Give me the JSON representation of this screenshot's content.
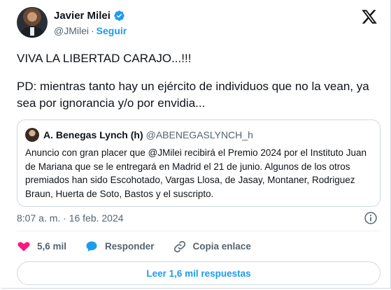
{
  "author": {
    "name": "Javier Milei",
    "handle": "@JMilei",
    "separator": "·",
    "follow_label": "Seguir"
  },
  "tweet": {
    "line1": "VIVA LA LIBERTAD CARAJO...!!!",
    "line2": "PD: mientras tanto hay un ejército de individuos que no la vean, ya sea por ignorancia y/o por envidia..."
  },
  "quote": {
    "name": "A. Benegas Lynch (h)",
    "handle": "@ABENEGASLYNCH_h",
    "text": "Anuncio con gran placer que @JMilei recibirá el Premio 2024 por el Instituto Juan de Mariana que se le entregará en Madrid el 21 de junio. Algunos de los otros premiados han sido Escohotado, Vargas Llosa, de Jasay, Montaner, Rodriguez Braun, Huerta de Soto, Bastos y el suscripto."
  },
  "timestamp": "8:07 a. m. · 16 feb. 2024",
  "actions": {
    "likes": "5,6 mil",
    "reply_label": "Responder",
    "copy_label": "Copia enlace"
  },
  "read_replies_label": "Leer 1,6 mil respuestas",
  "colors": {
    "accent": "#1d9bf0",
    "like": "#f91880",
    "muted": "#536471",
    "border": "#cfd9de"
  },
  "icons": [
    "verified-badge-icon",
    "x-logo-icon",
    "info-icon",
    "heart-icon",
    "reply-bubble-icon",
    "link-icon"
  ]
}
